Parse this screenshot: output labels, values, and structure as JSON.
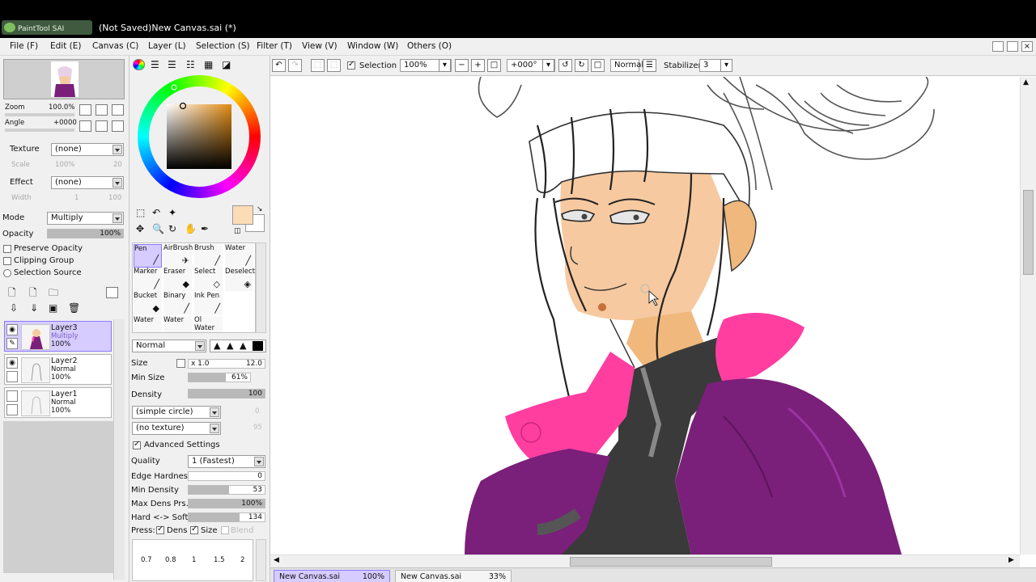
{
  "window": {
    "logo_text": "PaintTool SAI",
    "title": "(Not Saved)New Canvas.sai (*)"
  },
  "menu": [
    "File (F)",
    "Edit (E)",
    "Canvas (C)",
    "Layer (L)",
    "Selection (S)",
    "Filter (T)",
    "View (V)",
    "Window (W)",
    "Others (O)"
  ],
  "navigator": {
    "zoom_label": "Zoom",
    "zoom_value": "100.0%",
    "angle_label": "Angle",
    "angle_value": "+0000"
  },
  "texture": {
    "label": "Texture",
    "value": "(none)",
    "scale_label": "Scale",
    "scale_value": "100%",
    "amount": "20"
  },
  "effect": {
    "label": "Effect",
    "value": "(none)",
    "width_label": "Width",
    "width_value": "1",
    "amount": "100"
  },
  "layer_props": {
    "mode_label": "Mode",
    "mode_value": "Multiply",
    "opacity_label": "Opacity",
    "opacity_value": "100%",
    "opacity_fraction": 1.0,
    "preserve_opacity": "Preserve Opacity",
    "clipping_group": "Clipping Group",
    "selection_source": "Selection Source"
  },
  "layers": [
    {
      "name": "Layer3",
      "mode": "Multiply",
      "opacity": "100%",
      "selected": true
    },
    {
      "name": "Layer2",
      "mode": "Normal",
      "opacity": "100%",
      "selected": false
    },
    {
      "name": "Layer1",
      "mode": "Normal",
      "opacity": "100%",
      "selected": false
    }
  ],
  "tools": {
    "brushes": [
      [
        "Pen",
        "AirBrush",
        "Brush",
        "Water"
      ],
      [
        "Marker",
        "Eraser",
        "Select",
        "Deselect"
      ],
      [
        "Bucket",
        "Binary",
        "Ink Pen",
        ""
      ],
      [
        "Water",
        "Water",
        "Ol Water",
        ""
      ]
    ],
    "blend_mode": "Normal",
    "size_label": "Size",
    "size_multiplier": "x 1.0",
    "size_value": "12.0",
    "min_size_label": "Min Size",
    "min_size_value": "61%",
    "min_size_fraction": 0.61,
    "density_label": "Density",
    "density_value": "100",
    "density_fraction": 1.0,
    "shape": "(simple circle)",
    "shape_amount": "0",
    "texture": "(no texture)",
    "texture_amount": "95",
    "advanced_label": "Advanced Settings",
    "quality_label": "Quality",
    "quality_value": "1 (Fastest)",
    "edge_label": "Edge Hardness",
    "edge_value": "0",
    "min_density_label": "Min Density",
    "min_density_value": "53",
    "min_density_fraction": 0.53,
    "max_dens_label": "Max Dens Prs.",
    "max_dens_value": "100%",
    "max_dens_fraction": 1.0,
    "hard_soft_label": "Hard <-> Soft",
    "hard_soft_value": "134",
    "hard_soft_fraction": 0.67,
    "press_label": "Press:",
    "press_dens": "Dens",
    "press_size": "Size",
    "press_blend": "Blend",
    "brush_sizes": [
      "0.7",
      "0.8",
      "1",
      "1.5",
      "2"
    ]
  },
  "colors": {
    "primary": "#fcdcb6",
    "secondary": "#ffffff",
    "accent_select": "#d6ccff"
  },
  "canvas_toolbar": {
    "selection_label": "Selection",
    "zoom_value": "100%",
    "angle_value": "+000°",
    "mode_value": "Normal",
    "stabilizer_label": "Stabilizer",
    "stabilizer_value": "3"
  },
  "file_tabs": [
    {
      "name": "New Canvas.sai",
      "zoom": "100%",
      "active": true
    },
    {
      "name": "New Canvas.sai",
      "zoom": "33%",
      "active": false
    }
  ]
}
